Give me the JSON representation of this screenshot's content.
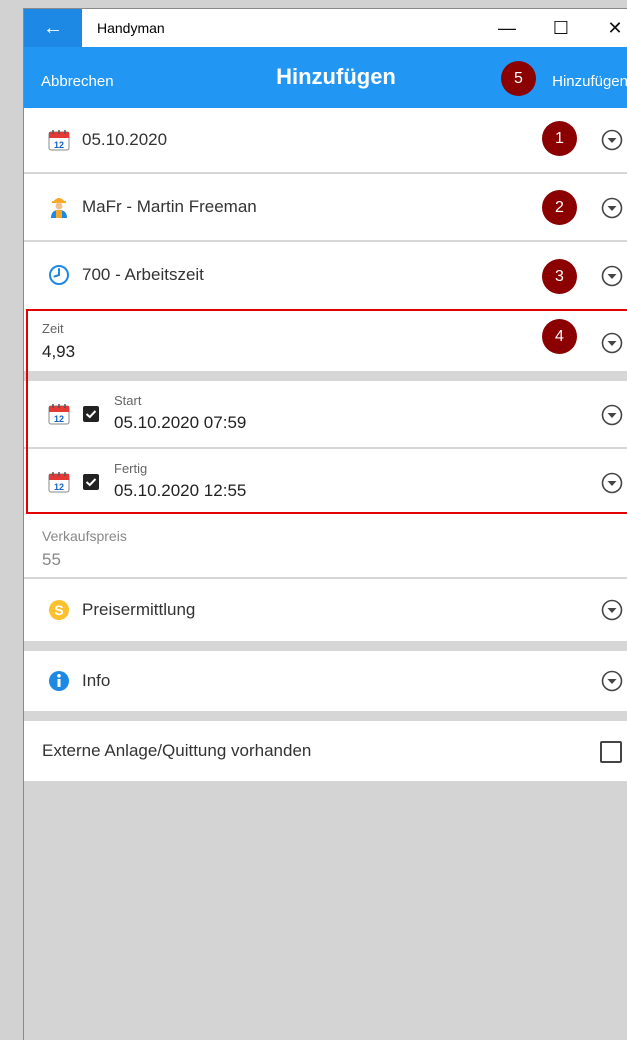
{
  "window": {
    "title": "Handyman",
    "back_icon": "arrow-left-icon",
    "min_glyph": "—",
    "max_glyph": "☐",
    "close_glyph": "✕"
  },
  "appbar": {
    "cancel": "Abbrechen",
    "title": "Hinzufügen",
    "add": "Hinzufügen",
    "color": "#2196f3"
  },
  "badges": [
    "1",
    "2",
    "3",
    "4",
    "5"
  ],
  "rows": {
    "date": {
      "value": "05.10.2020",
      "icon": "calendar-icon"
    },
    "employee": {
      "value": "MaFr - Martin Freeman",
      "icon": "worker-icon"
    },
    "activity": {
      "value": "700 - Arbeitszeit",
      "icon": "clock-icon"
    },
    "time": {
      "label": "Zeit",
      "value": "4,93"
    },
    "start": {
      "label": "Start",
      "value": "05.10.2020 07:59",
      "checked": true
    },
    "end": {
      "label": "Fertig",
      "value": "05.10.2020 12:55",
      "checked": true
    },
    "price": {
      "label": "Verkaufspreis",
      "value": "55"
    },
    "pricing": {
      "value": "Preisermittlung",
      "icon": "coin-icon"
    },
    "info": {
      "value": "Info",
      "icon": "info-icon"
    },
    "attachment": {
      "value": "Externe Anlage/Quittung vorhanden",
      "checked": false
    }
  }
}
